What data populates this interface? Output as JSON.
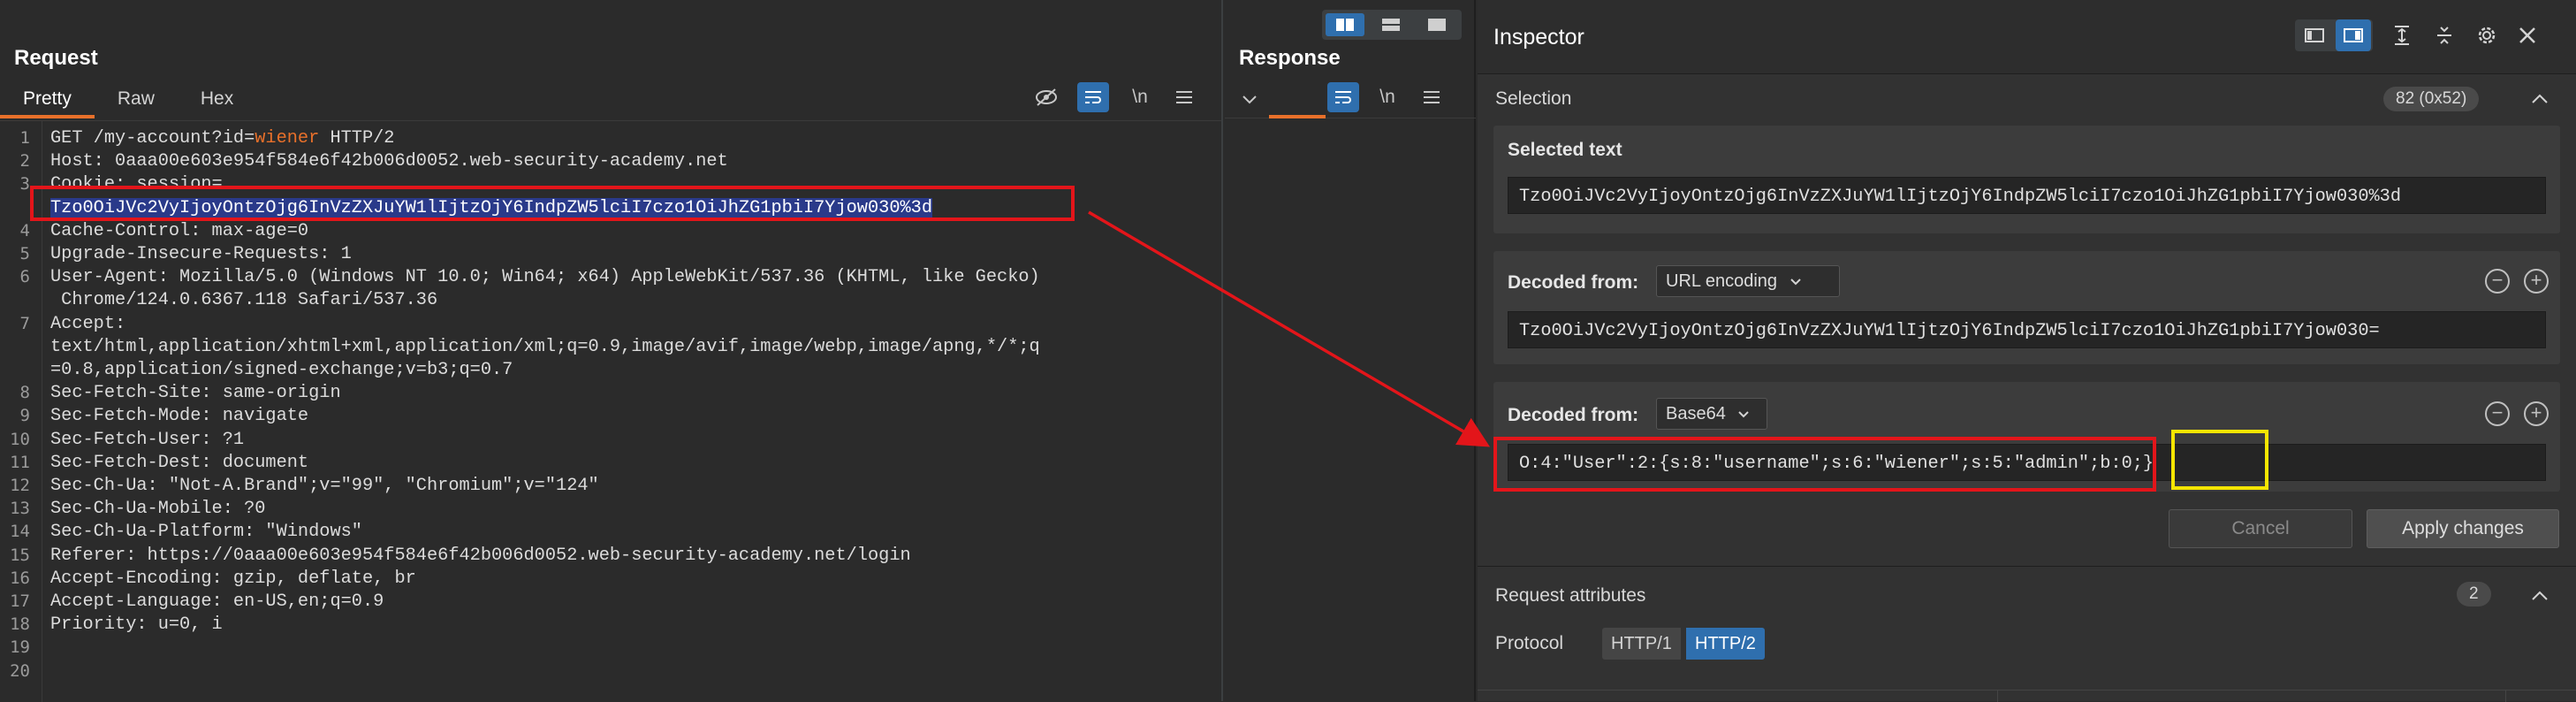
{
  "request": {
    "title": "Request",
    "tabs": [
      "Pretty",
      "Raw",
      "Hex"
    ],
    "active_tab": "Pretty",
    "newline_toggle": "\\n",
    "lines": [
      {
        "n": "1",
        "text": "GET /my-account?id=wiener HTTP/2"
      },
      {
        "n": "2",
        "text": "Host: 0aaa00e603e954f584e6f42b006d0052.web-security-academy.net"
      },
      {
        "n": "3",
        "text": "Cookie: session="
      },
      {
        "n": "",
        "text": "Tzo0OiJVc2VyIjoyOntzOjg6InVzZXJuYW1lIjtzOjY6IndpZW5lciI7czo1OiJhZG1pbiI7Yjow030%3d"
      },
      {
        "n": "4",
        "text": "Cache-Control: max-age=0"
      },
      {
        "n": "5",
        "text": "Upgrade-Insecure-Requests: 1"
      },
      {
        "n": "6",
        "text": "User-Agent: Mozilla/5.0 (Windows NT 10.0; Win64; x64) AppleWebKit/537.36 (KHTML, like Gecko)"
      },
      {
        "n": "",
        "text": " Chrome/124.0.6367.118 Safari/537.36"
      },
      {
        "n": "7",
        "text": "Accept:"
      },
      {
        "n": "",
        "text": "text/html,application/xhtml+xml,application/xml;q=0.9,image/avif,image/webp,image/apng,*/*;q"
      },
      {
        "n": "",
        "text": "=0.8,application/signed-exchange;v=b3;q=0.7"
      },
      {
        "n": "8",
        "text": "Sec-Fetch-Site: same-origin"
      },
      {
        "n": "9",
        "text": "Sec-Fetch-Mode: navigate"
      },
      {
        "n": "10",
        "text": "Sec-Fetch-User: ?1"
      },
      {
        "n": "11",
        "text": "Sec-Fetch-Dest: document"
      },
      {
        "n": "12",
        "text": "Sec-Ch-Ua: \"Not-A.Brand\";v=\"99\", \"Chromium\";v=\"124\""
      },
      {
        "n": "13",
        "text": "Sec-Ch-Ua-Mobile: ?0"
      },
      {
        "n": "14",
        "text": "Sec-Ch-Ua-Platform: \"Windows\""
      },
      {
        "n": "15",
        "text": "Referer: https://0aaa00e603e954f584e6f42b006d0052.web-security-academy.net/login"
      },
      {
        "n": "16",
        "text": "Accept-Encoding: gzip, deflate, br"
      },
      {
        "n": "17",
        "text": "Accept-Language: en-US,en;q=0.9"
      },
      {
        "n": "18",
        "text": "Priority: u=0, i"
      },
      {
        "n": "19",
        "text": ""
      },
      {
        "n": "20",
        "text": ""
      }
    ],
    "line1_prefix": "GET /my-account?id=",
    "line1_param": "wiener",
    "line1_suffix": " HTTP/2"
  },
  "response": {
    "title": "Response",
    "newline_toggle": "\\n"
  },
  "inspector": {
    "title": "Inspector",
    "selection": {
      "label": "Selection",
      "count": "82 (0x52)"
    },
    "selected_text": {
      "label": "Selected text",
      "value": "Tzo0OiJVc2VyIjoyOntzOjg6InVzZXJuYW1lIjtzOjY6IndpZW5lciI7czo1OiJhZG1pbiI7Yjow030%3d"
    },
    "decoded_url": {
      "label": "Decoded from:",
      "encoding": "URL encoding",
      "value": "Tzo0OiJVc2VyIjoyOntzOjg6InVzZXJuYW1lIjtzOjY6IndpZW5lciI7czo1OiJhZG1pbiI7Yjow030="
    },
    "decoded_b64": {
      "label": "Decoded from:",
      "encoding": "Base64",
      "value_prefix": "O:4:\"User\":2:{s:8:\"username\";s:6:\"wiener\";s:5:\"admin\";",
      "value_highlight": "b:0;}"
    },
    "buttons": {
      "cancel": "Cancel",
      "apply": "Apply changes"
    },
    "request_attributes": {
      "label": "Request attributes",
      "count": "2",
      "protocol_label": "Protocol",
      "protocols": [
        "HTTP/1",
        "HTTP/2"
      ],
      "active_protocol": "HTTP/2"
    }
  },
  "colors": {
    "background": "#2b2b2b",
    "accent": "#e8702a",
    "active_blue": "#2f6fae",
    "annotation_red": "#e3151a",
    "annotation_yellow": "#f5e500"
  }
}
